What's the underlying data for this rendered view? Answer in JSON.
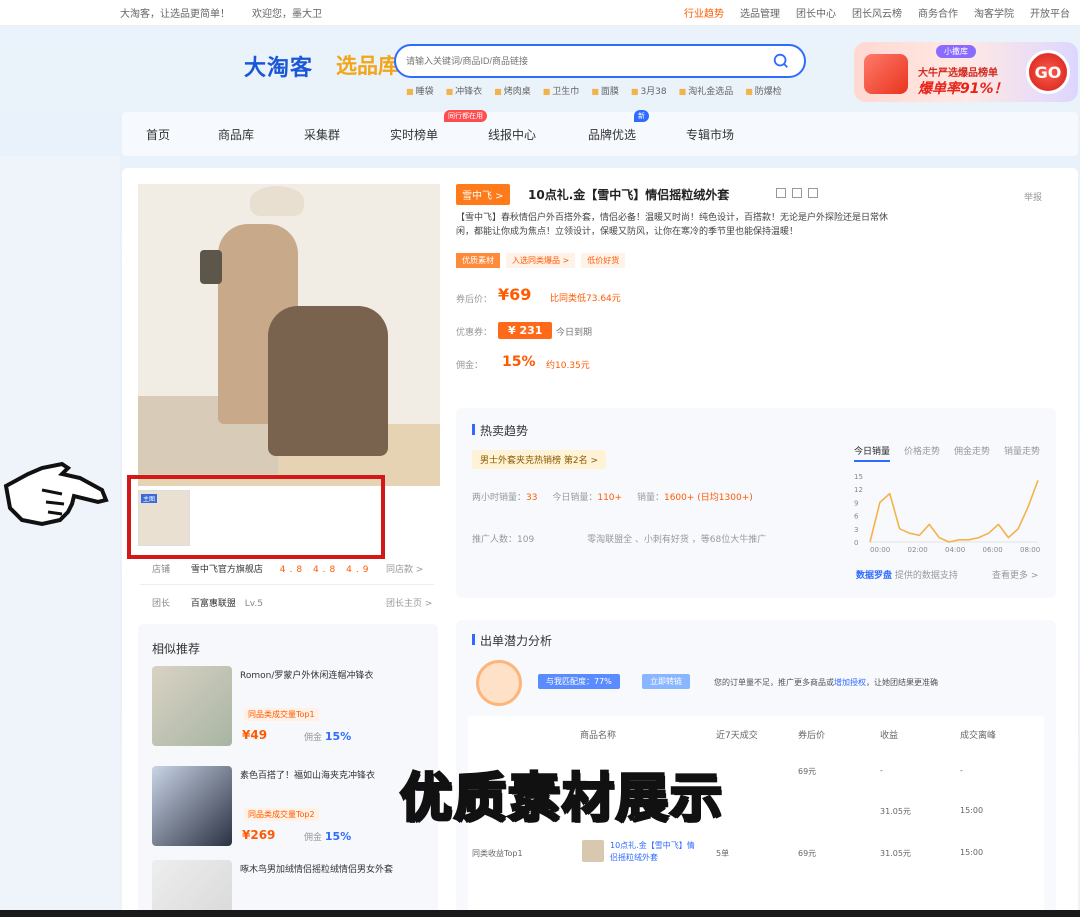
{
  "topbar": {
    "left": [
      "大淘客，让选品更简单！",
      "欢迎您，墨大卫"
    ],
    "right": [
      "行业趋势",
      "选品管理",
      "团长中心",
      "团长风云榜",
      "商务合作",
      "淘客学院",
      "开放平台"
    ]
  },
  "brand": {
    "logo": "大淘客",
    "sub": "选品库"
  },
  "search": {
    "placeholder": "请输入关键词/商品ID/商品链接",
    "hotwords": [
      "睡袋",
      "冲锋衣",
      "烤肉桌",
      "卫生巾",
      "面膜",
      "3月38",
      "淘礼金选品",
      "防爆检"
    ]
  },
  "promo": {
    "tag": "小撒库",
    "line1": "大牛严选爆品榜单",
    "line2": "爆单率91%！",
    "go": "GO"
  },
  "nav": {
    "items": [
      "首页",
      "商品库",
      "采集群",
      "实时榜单",
      "线报中心",
      "品牌优选",
      "专辑市场"
    ],
    "badge_red": "同行都在用",
    "badge_blue": "新"
  },
  "product": {
    "tag": "雪中飞 >",
    "title": "10点礼.金【雪中飞】情侣摇粒绒外套",
    "desc": "【雪中飞】春秋情侣户外百搭外套，情侣必备！温暖又时尚！纯色设计，百搭款！无论是户外探险还是日常休闲，都能让你成为焦点！立领设计，保暖又防风，让你在寒冷的季节里也能保持温暖！",
    "pills": [
      "优质素材",
      "入选同类爆品 >",
      "低价好货"
    ],
    "price_label": "券后价：",
    "price": "¥69",
    "price_cmp": "比同类低73.64元",
    "coupon_label": "优惠券：",
    "coupon": "¥ 231",
    "coupon_sub": "今日到期",
    "comm_label": "佣金：",
    "comm_pct": "15%",
    "comm_amt": "约10.35元",
    "share": "举报"
  },
  "thumb_label": "主图",
  "shop": {
    "label": "店铺",
    "name": "雪中飞官方旗舰店",
    "scores": "4.8  4.8  4.9",
    "more": "同店款 >",
    "leader_label": "团长",
    "leader_name": "百富惠联盟",
    "leader_level": "Lv.5",
    "leader_more": "团长主页 >"
  },
  "similar": {
    "title": "相似推荐",
    "items": [
      {
        "title": "Romon/罗蒙户外休闲连帽冲锋衣",
        "tag": "同品类成交量Top1",
        "price": "¥49",
        "comm_label": "佣金",
        "comm": "15%"
      },
      {
        "title": "素色百搭了！福如山海夹克冲锋衣",
        "tag": "同品类成交量Top2",
        "price": "¥269",
        "comm_label": "佣金",
        "comm": "15%"
      },
      {
        "title": "啄木鸟男加绒情侣摇粒绒情侣男女外套",
        "tag": "",
        "price": "",
        "comm_label": "",
        "comm": ""
      }
    ]
  },
  "trend": {
    "title": "热卖趋势",
    "rank": "男士外套夹克热销榜 第2名 >",
    "stats_2h": "两小时销量：",
    "stats_2h_val": "33",
    "stats_today": "今日销量：",
    "stats_today_val": "110+",
    "stats_total": "销量：",
    "stats_total_val": "1600+ (日均1300+)",
    "promoters_label": "推广人数：109",
    "promoters_text": "零淘联盟全 、小刺有好货 ，等68位大牛推广",
    "tabs": [
      "今日销量",
      "价格走势",
      "佣金走势",
      "销量走势"
    ],
    "chart_foot_a": "数据罗盘",
    "chart_foot_b": "提供的数据支持",
    "chart_foot_more": "查看更多 >"
  },
  "chart_data": {
    "type": "line",
    "x": [
      "00:00",
      "02:00",
      "04:00",
      "06:00",
      "08:00"
    ],
    "yticks": [
      0,
      3,
      6,
      9,
      12,
      15
    ],
    "ylim": [
      0,
      15
    ],
    "series": [
      {
        "values": [
          0,
          9,
          11,
          3,
          2,
          1.5,
          4,
          1,
          0,
          0.5,
          0.5,
          1,
          2,
          4,
          1,
          3,
          8,
          14
        ]
      }
    ],
    "color": "#f5b24a"
  },
  "potential": {
    "title": "出单潜力分析",
    "b1": "与我匹配度：77%",
    "b2": "立即转链",
    "text_a": "您的订单量不足，推广更多商品或",
    "text_link": "增加授权",
    "text_b": "，让她团结果更准确",
    "headers": [
      "商品名称",
      "近7天成交",
      "券后价",
      "收益",
      "成交离峰"
    ],
    "rows": [
      {
        "label": "",
        "name": "",
        "sales": "",
        "price": "69元",
        "profit": "-",
        "peak": "-"
      },
      {
        "label": "",
        "name": "",
        "sales": "",
        "price": "",
        "profit": "31.05元",
        "peak": "15:00"
      },
      {
        "label": "同类收益Top1",
        "name": "10点礼.金【雪中飞】情侣摇粒绒外套",
        "sales": "5单",
        "price": "69元",
        "profit": "31.05元",
        "peak": "15:00"
      }
    ]
  },
  "caption": "优质素材展示"
}
